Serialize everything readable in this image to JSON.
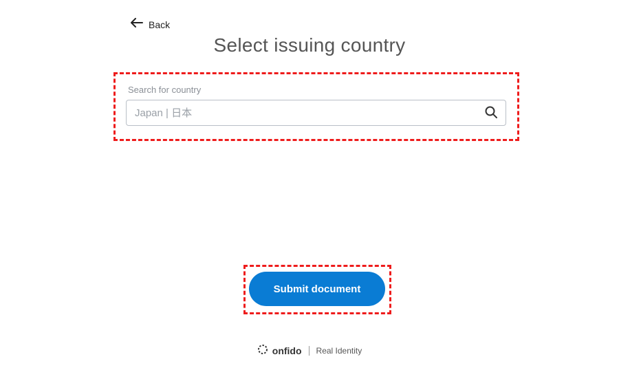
{
  "nav": {
    "back_label": "Back"
  },
  "title": "Select issuing country",
  "search": {
    "label": "Search for country",
    "placeholder": "Japan | 日本"
  },
  "submit": {
    "label": "Submit document"
  },
  "footer": {
    "brand": "onfido",
    "tagline": "Real Identity"
  }
}
